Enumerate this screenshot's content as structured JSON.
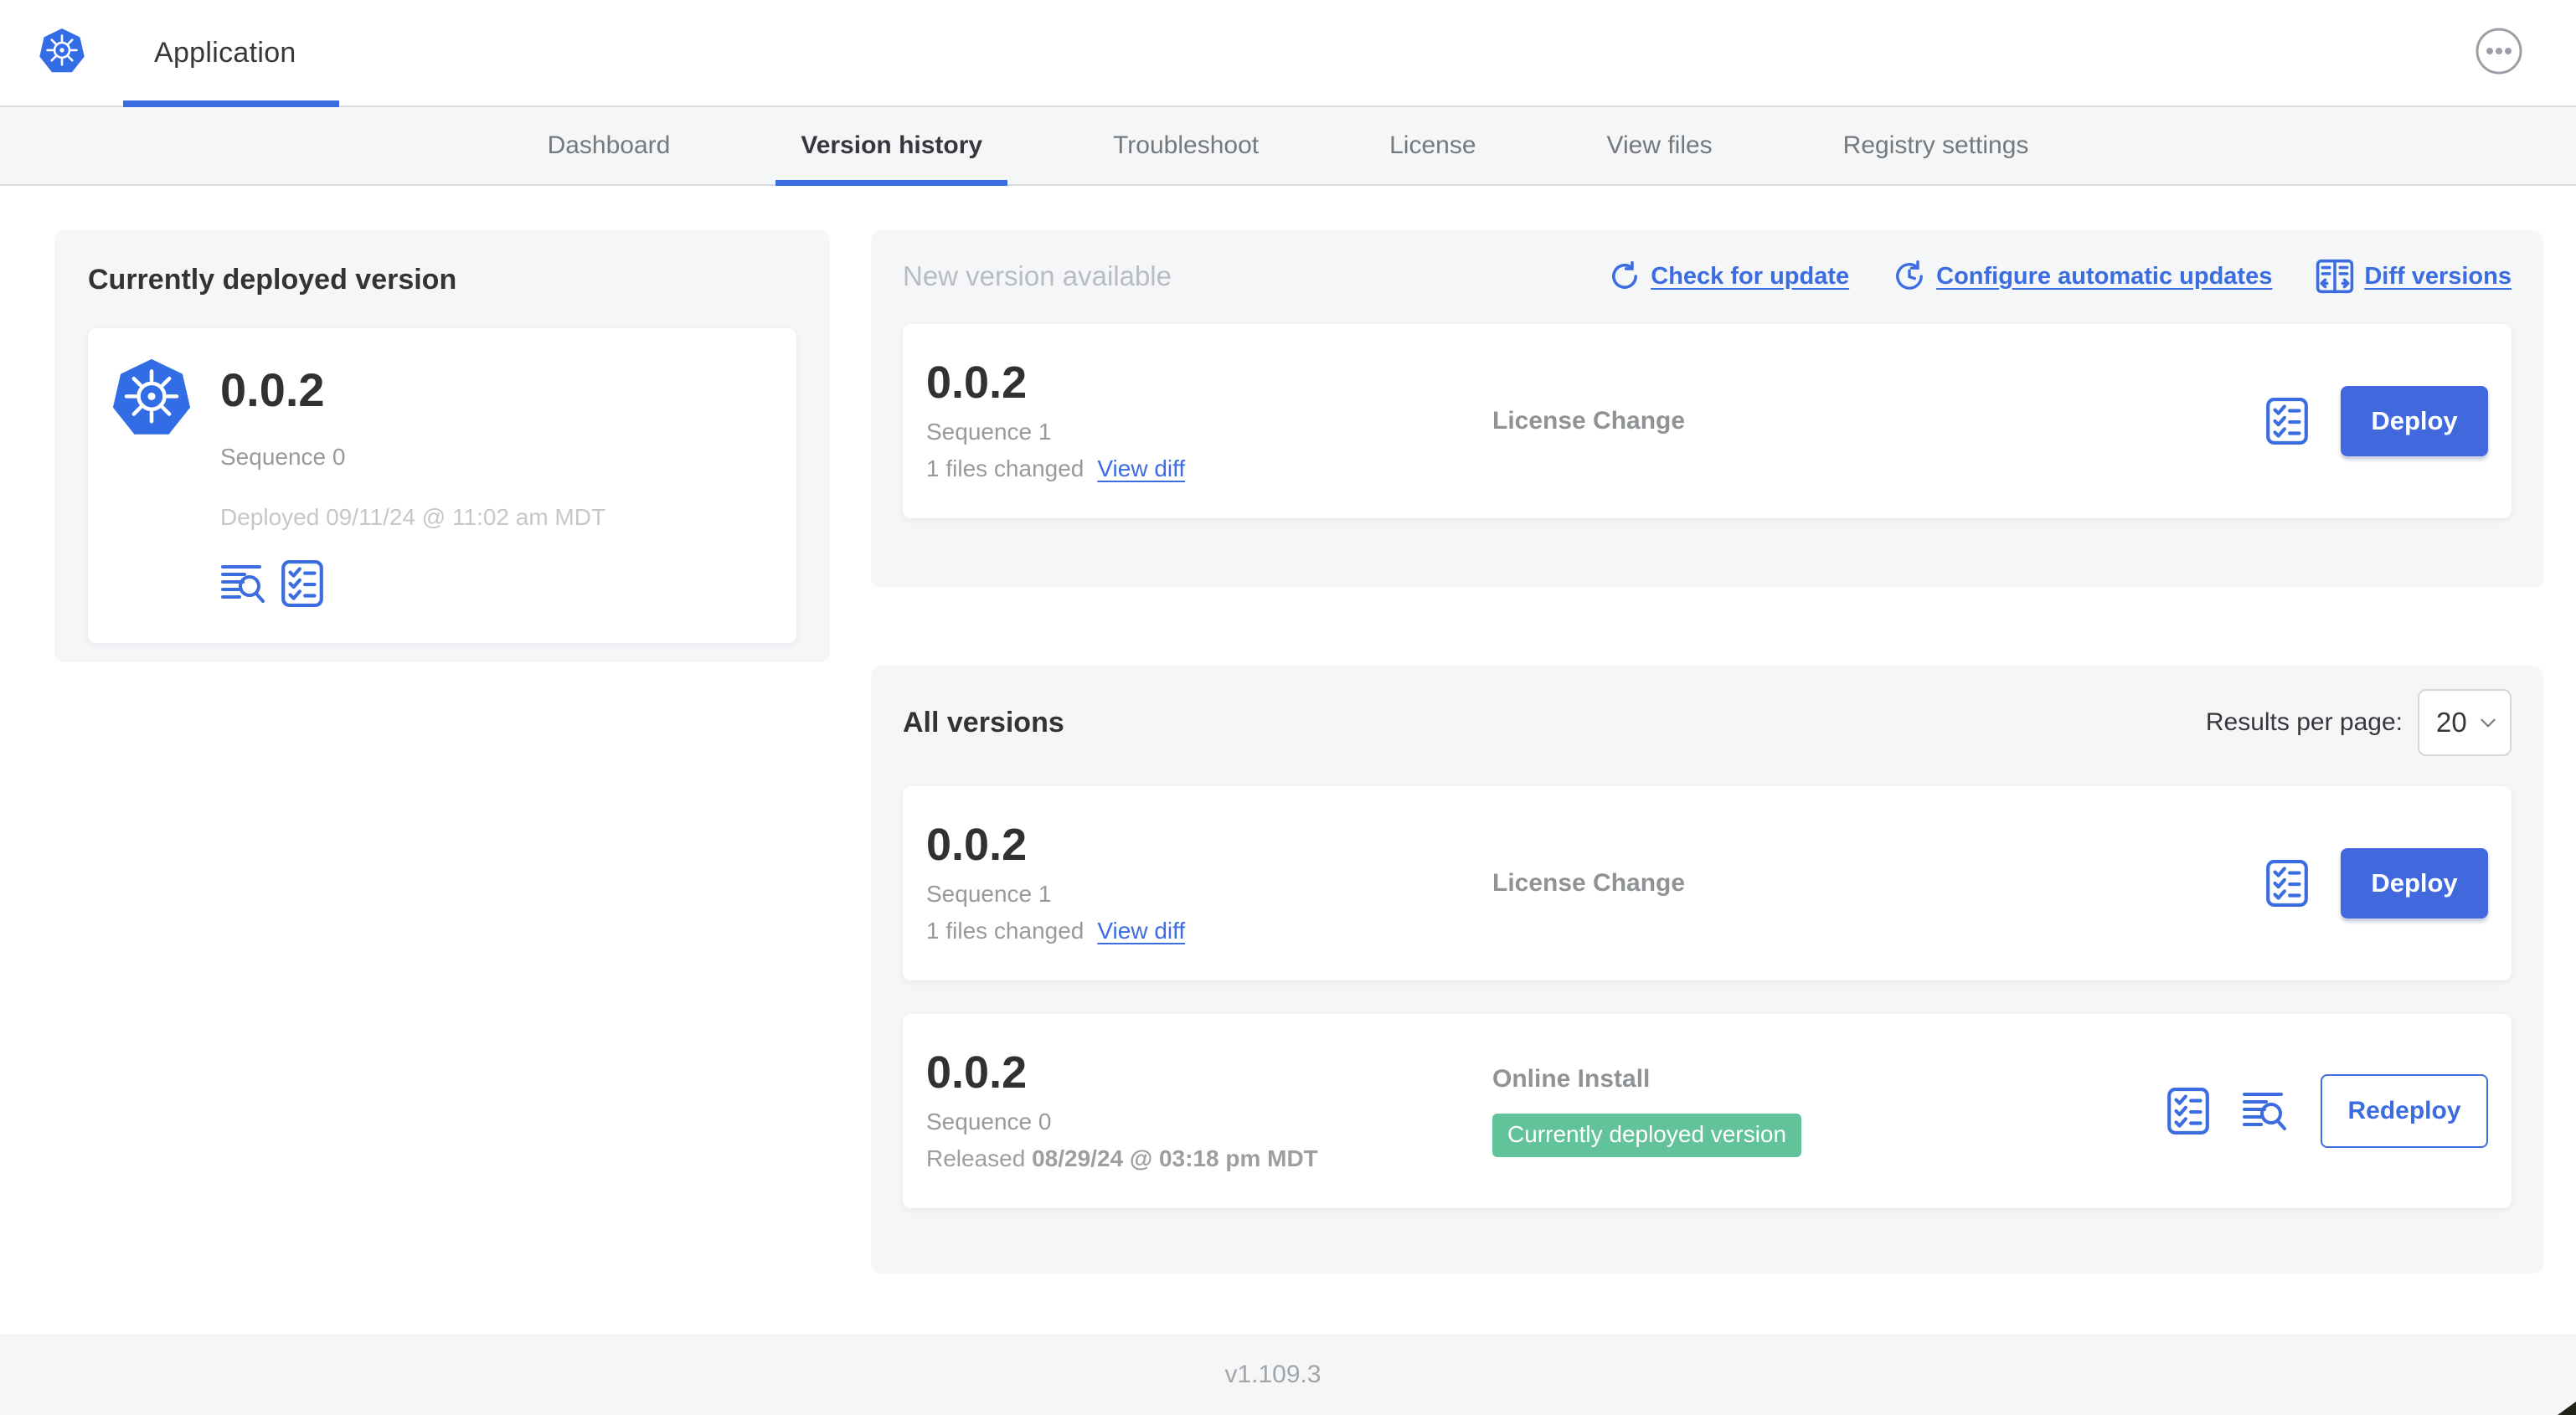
{
  "header": {
    "app_title": "Application"
  },
  "nav": {
    "tabs": [
      {
        "label": "Dashboard",
        "active": false
      },
      {
        "label": "Version history",
        "active": true
      },
      {
        "label": "Troubleshoot",
        "active": false
      },
      {
        "label": "License",
        "active": false
      },
      {
        "label": "View files",
        "active": false
      },
      {
        "label": "Registry settings",
        "active": false
      }
    ]
  },
  "current_version_panel": {
    "title": "Currently deployed version",
    "version": "0.0.2",
    "sequence": "Sequence 0",
    "deployed": "Deployed 09/11/24 @ 11:02 am MDT"
  },
  "new_version_panel": {
    "title": "New version available",
    "links": [
      {
        "label": "Check for update",
        "icon": "refresh-icon"
      },
      {
        "label": "Configure automatic updates",
        "icon": "clock-refresh-icon"
      },
      {
        "label": "Diff versions",
        "icon": "diff-icon"
      }
    ],
    "card": {
      "version": "0.0.2",
      "sequence": "Sequence 1",
      "files_changed": "1 files changed",
      "view_diff_label": "View diff",
      "source": "License Change",
      "action_label": "Deploy"
    }
  },
  "all_versions_panel": {
    "title": "All versions",
    "results_per_page_label": "Results per page:",
    "results_per_page_value": "20",
    "rows": [
      {
        "version": "0.0.2",
        "sequence": "Sequence 1",
        "files_changed": "1 files changed",
        "view_diff_label": "View diff",
        "source": "License Change",
        "action_label": "Deploy"
      },
      {
        "version": "0.0.2",
        "sequence": "Sequence 0",
        "released_prefix": "Released ",
        "released_date": "08/29/24 @ 03:18 pm MDT",
        "source": "Online Install",
        "badge": "Currently deployed version",
        "action_label": "Redeploy"
      }
    ]
  },
  "footer": {
    "version": "v1.109.3"
  },
  "colors": {
    "accent_blue": "#3b6ce0",
    "button_blue": "#4169dd",
    "badge_green": "#62c39b",
    "panel_gray": "#f4f6f8",
    "muted_text": "#969a9d"
  }
}
